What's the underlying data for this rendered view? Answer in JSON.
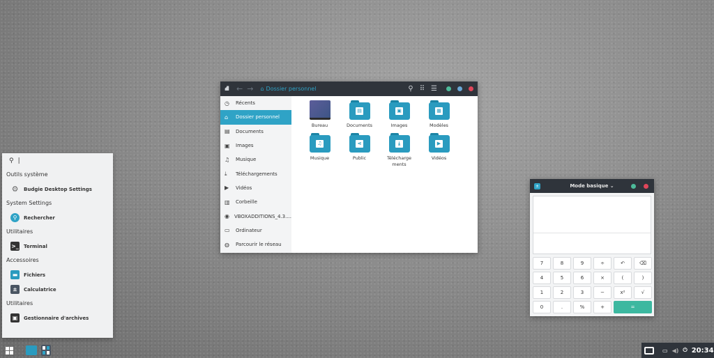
{
  "file_manager": {
    "breadcrumb": "Dossier personnel",
    "sidebar": [
      "Récents",
      "Dossier personnel",
      "Documents",
      "Images",
      "Musique",
      "Téléchargements",
      "Vidéos",
      "Corbeille",
      "VBOXADDITIONS_4.3....",
      "Ordinateur",
      "Parcourir le réseau"
    ],
    "sidebar_icons": [
      "clock-icon",
      "home-icon",
      "document-icon",
      "image-icon",
      "music-icon",
      "download-icon",
      "video-icon",
      "trash-icon",
      "disc-icon",
      "computer-icon",
      "network-icon"
    ],
    "items": [
      {
        "label": "Bureau",
        "icon": "desktop-folder-icon"
      },
      {
        "label": "Documents",
        "icon": "document-folder-icon"
      },
      {
        "label": "Images",
        "icon": "image-folder-icon"
      },
      {
        "label": "Modèles",
        "icon": "template-folder-icon"
      },
      {
        "label": "Musique",
        "icon": "music-folder-icon"
      },
      {
        "label": "Public",
        "icon": "share-folder-icon"
      },
      {
        "label": "Téléchargements",
        "icon": "download-folder-icon"
      },
      {
        "label": "Vidéos",
        "icon": "video-folder-icon"
      }
    ]
  },
  "menu": {
    "search_value": "",
    "sections": [
      {
        "category": "Outils système",
        "apps": [
          "Budgie Desktop Settings"
        ]
      },
      {
        "category": "System Settings",
        "apps": [
          "Rechercher"
        ]
      },
      {
        "category": "Utilitaires",
        "apps": [
          "Terminal"
        ]
      },
      {
        "category": "Accessoires",
        "apps": [
          "Fichiers",
          "Calculatrice"
        ]
      },
      {
        "category": "Utilitaires",
        "apps": [
          "Gestionnaire d'archives"
        ]
      }
    ]
  },
  "calculator": {
    "title": "Mode basique",
    "keys": [
      "7",
      "8",
      "9",
      "÷",
      "↶",
      "⌫",
      "4",
      "5",
      "6",
      "×",
      "(",
      ")",
      "1",
      "2",
      "3",
      "−",
      "x²",
      "√",
      "0",
      ".",
      "%",
      "+",
      "="
    ]
  },
  "panel": {
    "clock": "20:34"
  },
  "colors": {
    "accent": "#2fa3c6",
    "equals": "#3cb8a0",
    "titlebar": "#2f343b"
  }
}
